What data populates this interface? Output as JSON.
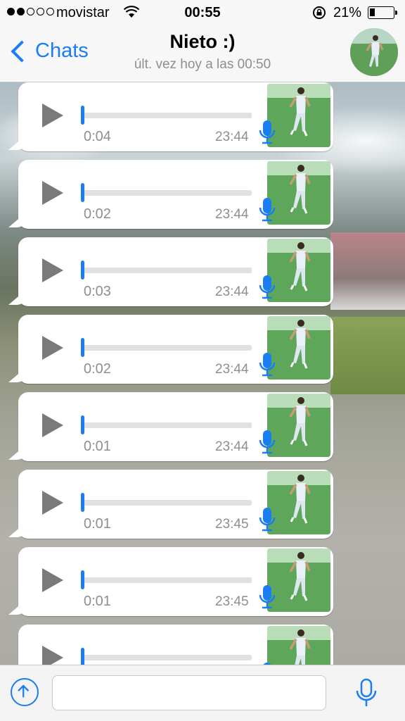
{
  "status_bar": {
    "carrier": "movistar",
    "time": "00:55",
    "battery_percent": "21%",
    "battery_level": 0.21,
    "signal_bars_filled": 2,
    "signal_bars_total": 5
  },
  "nav": {
    "back_label": "Chats",
    "contact_name": "Nieto :)",
    "last_seen": "últ. vez hoy a las 00:50"
  },
  "messages": [
    {
      "duration": "0:04",
      "time": "23:44"
    },
    {
      "duration": "0:02",
      "time": "23:44"
    },
    {
      "duration": "0:03",
      "time": "23:44"
    },
    {
      "duration": "0:02",
      "time": "23:44"
    },
    {
      "duration": "0:01",
      "time": "23:44"
    },
    {
      "duration": "0:01",
      "time": "23:45"
    },
    {
      "duration": "0:01",
      "time": "23:45"
    },
    {
      "duration": "",
      "time": ""
    }
  ],
  "input": {
    "placeholder": "",
    "value": ""
  },
  "colors": {
    "accent": "#1a7ef2",
    "bubble": "#ffffff",
    "secondary_text": "#8e8e93"
  },
  "icons": {
    "back": "chevron-left-icon",
    "play": "play-icon",
    "voice_note": "microphone-icon",
    "attach": "upload-icon",
    "record": "microphone-icon"
  }
}
